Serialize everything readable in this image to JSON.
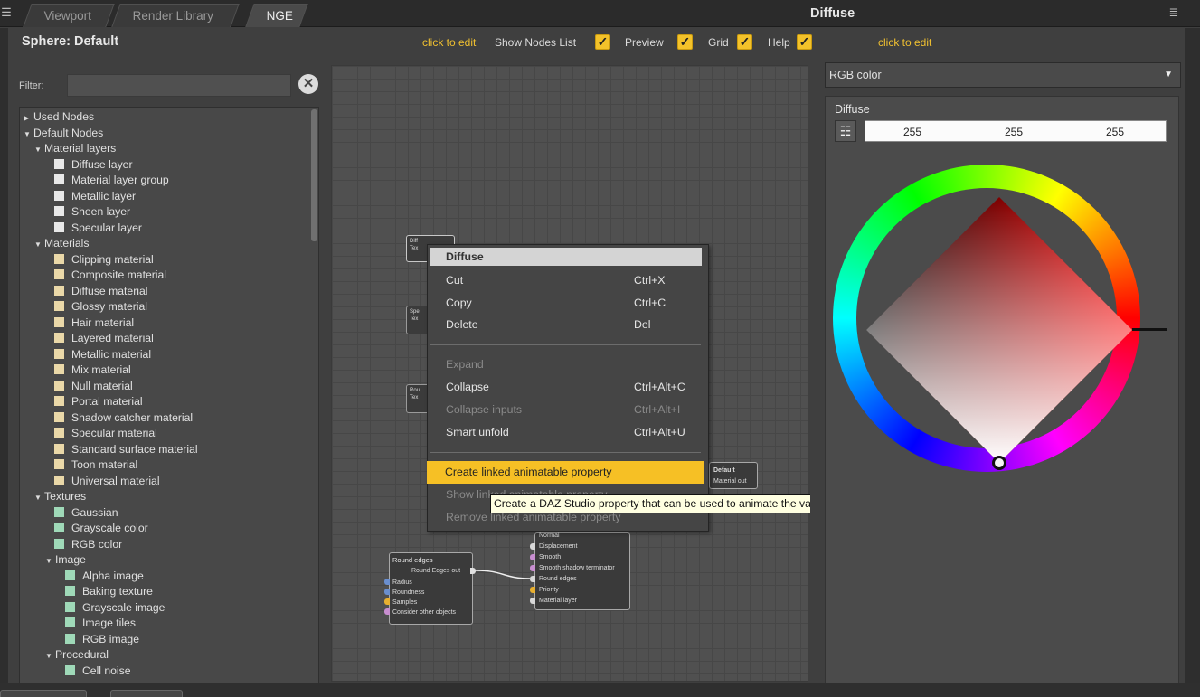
{
  "tabs": [
    "Viewport",
    "Render Library",
    "NGE"
  ],
  "active_tab": "NGE",
  "header": {
    "node_title": "Sphere: Default",
    "click_to_edit_1": "click to edit",
    "show_nodes_list": "Show Nodes List",
    "preview": "Preview",
    "grid": "Grid",
    "help": "Help",
    "diffuse_title": "Diffuse",
    "click_to_edit_2": "click to edit",
    "checkbox_states": {
      "show_nodes_list": true,
      "preview": true,
      "grid": true,
      "help": true
    }
  },
  "filter": {
    "label": "Filter:",
    "value": ""
  },
  "tree": [
    {
      "label": "Used Nodes",
      "level": 0,
      "type": "collapsed"
    },
    {
      "label": "Default Nodes",
      "level": 0,
      "type": "expanded"
    },
    {
      "label": "Material layers",
      "level": 1,
      "type": "expanded"
    },
    {
      "label": "Diffuse layer",
      "level": 2,
      "type": "item",
      "color": "#e8e8e8"
    },
    {
      "label": "Material layer group",
      "level": 2,
      "type": "item",
      "color": "#e8e8e8"
    },
    {
      "label": "Metallic layer",
      "level": 2,
      "type": "item",
      "color": "#e8e8e8"
    },
    {
      "label": "Sheen layer",
      "level": 2,
      "type": "item",
      "color": "#e8e8e8"
    },
    {
      "label": "Specular layer",
      "level": 2,
      "type": "item",
      "color": "#e8e8e8"
    },
    {
      "label": "Materials",
      "level": 1,
      "type": "expanded"
    },
    {
      "label": "Clipping material",
      "level": 2,
      "type": "item",
      "color": "#ead8a8"
    },
    {
      "label": "Composite material",
      "level": 2,
      "type": "item",
      "color": "#ead8a8"
    },
    {
      "label": "Diffuse material",
      "level": 2,
      "type": "item",
      "color": "#ead8a8"
    },
    {
      "label": "Glossy material",
      "level": 2,
      "type": "item",
      "color": "#ead8a8"
    },
    {
      "label": "Hair material",
      "level": 2,
      "type": "item",
      "color": "#ead8a8"
    },
    {
      "label": "Layered material",
      "level": 2,
      "type": "item",
      "color": "#ead8a8"
    },
    {
      "label": "Metallic material",
      "level": 2,
      "type": "item",
      "color": "#ead8a8"
    },
    {
      "label": "Mix material",
      "level": 2,
      "type": "item",
      "color": "#ead8a8"
    },
    {
      "label": "Null material",
      "level": 2,
      "type": "item",
      "color": "#ead8a8"
    },
    {
      "label": "Portal material",
      "level": 2,
      "type": "item",
      "color": "#ead8a8"
    },
    {
      "label": "Shadow catcher material",
      "level": 2,
      "type": "item",
      "color": "#ead8a8"
    },
    {
      "label": "Specular material",
      "level": 2,
      "type": "item",
      "color": "#ead8a8"
    },
    {
      "label": "Standard surface material",
      "level": 2,
      "type": "item",
      "color": "#ead8a8"
    },
    {
      "label": "Toon material",
      "level": 2,
      "type": "item",
      "color": "#ead8a8"
    },
    {
      "label": "Universal material",
      "level": 2,
      "type": "item",
      "color": "#ead8a8"
    },
    {
      "label": "Textures",
      "level": 1,
      "type": "expanded"
    },
    {
      "label": "Gaussian",
      "level": 2,
      "type": "item",
      "color": "#9fd9b8"
    },
    {
      "label": "Grayscale color",
      "level": 2,
      "type": "item",
      "color": "#9fd9b8"
    },
    {
      "label": "RGB color",
      "level": 2,
      "type": "item",
      "color": "#9fd9b8"
    },
    {
      "label": "Image",
      "level": 2,
      "type": "expanded"
    },
    {
      "label": "Alpha image",
      "level": 3,
      "type": "item",
      "color": "#9fd9b8"
    },
    {
      "label": "Baking texture",
      "level": 3,
      "type": "item",
      "color": "#9fd9b8"
    },
    {
      "label": "Grayscale image",
      "level": 3,
      "type": "item",
      "color": "#9fd9b8"
    },
    {
      "label": "Image tiles",
      "level": 3,
      "type": "item",
      "color": "#9fd9b8"
    },
    {
      "label": "RGB image",
      "level": 3,
      "type": "item",
      "color": "#9fd9b8"
    },
    {
      "label": "Procedural",
      "level": 2,
      "type": "expanded"
    },
    {
      "label": "Cell noise",
      "level": 3,
      "type": "item",
      "color": "#9fd9b8"
    }
  ],
  "graph": {
    "mini_nodes": [
      {
        "line1": "Diff",
        "line2": "Tex"
      },
      {
        "line1": "Spe",
        "line2": "Tex"
      },
      {
        "line1": "Rou",
        "line2": "Tex"
      }
    ],
    "round_edges_node": {
      "title": "Round edges",
      "output": "Round Edges out",
      "inputs": [
        {
          "label": "Radius",
          "color": "#6a8fcf"
        },
        {
          "label": "Roundness",
          "color": "#6a8fcf"
        },
        {
          "label": "Samples",
          "color": "#e8b030"
        },
        {
          "label": "Consider other objects",
          "color": "#c88ed0"
        }
      ]
    },
    "material_node": {
      "inputs": [
        {
          "label": "Normal",
          "color": "#d8d8d8"
        },
        {
          "label": "Displacement",
          "color": "#d8d8d8"
        },
        {
          "label": "Smooth",
          "color": "#c88ed0"
        },
        {
          "label": "Smooth shadow terminator",
          "color": "#c88ed0"
        },
        {
          "label": "Round edges",
          "color": "#d8d8d8"
        },
        {
          "label": "Priority",
          "color": "#e8b030"
        },
        {
          "label": "Material layer",
          "color": "#d8d8d8"
        }
      ]
    },
    "default_node": {
      "title": "Default",
      "output": "Material out"
    }
  },
  "context_menu": {
    "title": "Diffuse",
    "items": [
      {
        "label": "Cut",
        "shortcut": "Ctrl+X",
        "disabled": false
      },
      {
        "label": "Copy",
        "shortcut": "Ctrl+C",
        "disabled": false
      },
      {
        "label": "Delete",
        "shortcut": "Del",
        "disabled": false
      },
      {
        "label": "Expand",
        "shortcut": "",
        "disabled": true
      },
      {
        "label": "Collapse",
        "shortcut": "Ctrl+Alt+C",
        "disabled": false
      },
      {
        "label": "Collapse inputs",
        "shortcut": "Ctrl+Alt+I",
        "disabled": true
      },
      {
        "label": "Smart unfold",
        "shortcut": "Ctrl+Alt+U",
        "disabled": false
      },
      {
        "label": "Create linked animatable property",
        "shortcut": "",
        "disabled": false,
        "highlighted": true
      },
      {
        "label": "Show linked animatable property",
        "shortcut": "",
        "disabled": true
      },
      {
        "label": "Remove linked animatable property",
        "shortcut": "",
        "disabled": true
      }
    ],
    "tooltip": "Create a DAZ Studio property that can be used to animate the value of this node using the DAZ Studio timeline."
  },
  "color_panel": {
    "mode": "RGB color",
    "label": "Diffuse",
    "r": "255",
    "g": "255",
    "b": "255",
    "hue_deg": 0
  },
  "colors": {
    "accent": "#f6c025",
    "link": "#f0c030"
  }
}
